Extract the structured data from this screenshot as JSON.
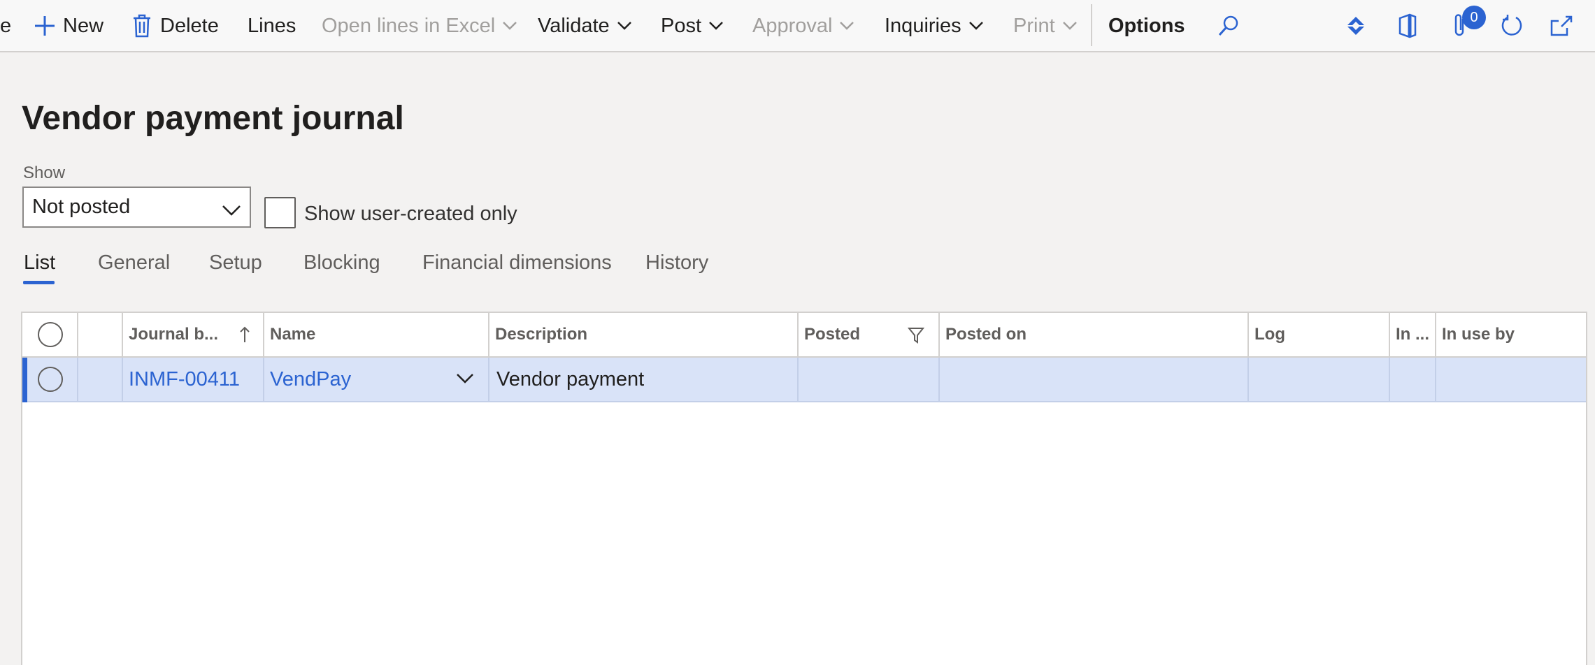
{
  "actionbar": {
    "partial_left": "e",
    "new_label": "New",
    "delete_label": "Delete",
    "lines_label": "Lines",
    "open_excel_label": "Open lines in Excel",
    "validate_label": "Validate",
    "post_label": "Post",
    "approval_label": "Approval",
    "inquiries_label": "Inquiries",
    "print_label": "Print",
    "options_label": "Options",
    "attachments_count": "0"
  },
  "page": {
    "title": "Vendor payment journal",
    "show_label": "Show",
    "show_value": "Not posted",
    "user_created_label": "Show user-created only",
    "user_created_checked": false
  },
  "tabs": [
    {
      "label": "List",
      "active": true
    },
    {
      "label": "General",
      "active": false
    },
    {
      "label": "Setup",
      "active": false
    },
    {
      "label": "Blocking",
      "active": false
    },
    {
      "label": "Financial dimensions",
      "active": false
    },
    {
      "label": "History",
      "active": false
    }
  ],
  "grid": {
    "columns": {
      "journal_batch": "Journal b...",
      "name": "Name",
      "description": "Description",
      "posted": "Posted",
      "posted_on": "Posted on",
      "log": "Log",
      "in_use": "In ...",
      "in_use_by": "In use by"
    },
    "sort_column": "journal_batch",
    "filtered_column": "posted",
    "rows": [
      {
        "journal_batch": "INMF-00411",
        "name": "VendPay",
        "description": "Vendor payment",
        "posted": "",
        "posted_on": "",
        "log": "",
        "in_use": "",
        "in_use_by": "",
        "selected": true
      }
    ]
  },
  "colors": {
    "accent": "#2b63d1",
    "selected_row": "#d9e3f8",
    "disabled_text": "#a19f9d",
    "background": "#f3f2f1"
  },
  "icons": {
    "new": "plus-icon",
    "delete": "trash-icon",
    "search": "search-icon",
    "power_apps": "power-apps-icon",
    "office": "office-icon",
    "attachments": "paperclip-icon",
    "refresh": "refresh-icon",
    "popout": "open-in-new-window-icon",
    "filter": "filter-icon",
    "sort": "sort-ascending-icon"
  }
}
